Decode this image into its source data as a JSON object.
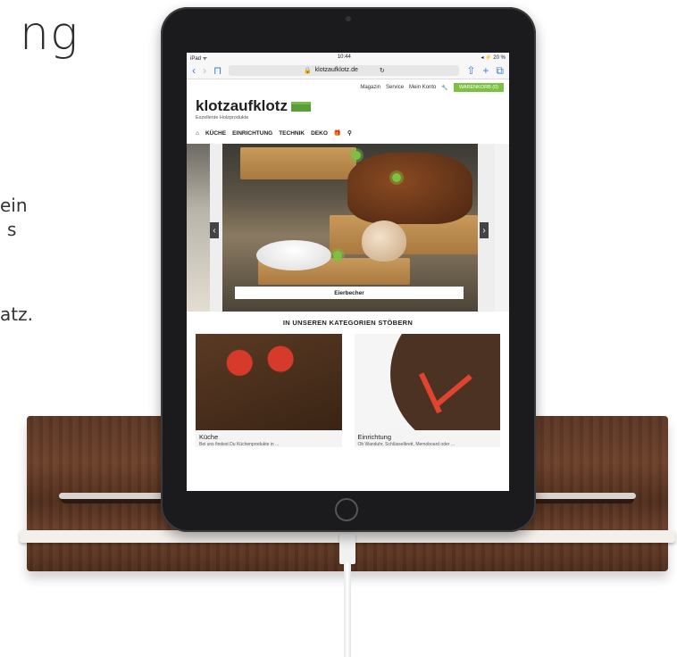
{
  "page": {
    "heading_fragment": "ng",
    "fragments": [
      "ein",
      "s",
      "atz."
    ]
  },
  "ipad": {
    "status": {
      "left": "iPad ᯤ",
      "time": "10:44",
      "right": "◂ ⚡ 20 %"
    },
    "url": "klotzaufklotz.de",
    "top_links": [
      "Magazin",
      "Service",
      "Mein Konto"
    ],
    "cart": "WARENKORB (0)",
    "logo": "klotzaufklotz",
    "tagline": "Exzellente Holzprodukte",
    "menu": [
      "KÜCHE",
      "EINRICHTUNG",
      "TECHNIK",
      "DEKO"
    ],
    "hero_label": "Eierbecher",
    "section_heading": "IN UNSEREN KATEGORIEN STÖBERN",
    "categories": [
      {
        "title": "Küche",
        "text": "Bei uns findest Du Küchenprodukte in ..."
      },
      {
        "title": "Einrichtung",
        "text": "Ob Wanduhr, Schlüsselbrett, Memoboard oder ..."
      }
    ]
  },
  "colors": {
    "accent_green": "#7cc142",
    "wood": "#5a3624"
  }
}
